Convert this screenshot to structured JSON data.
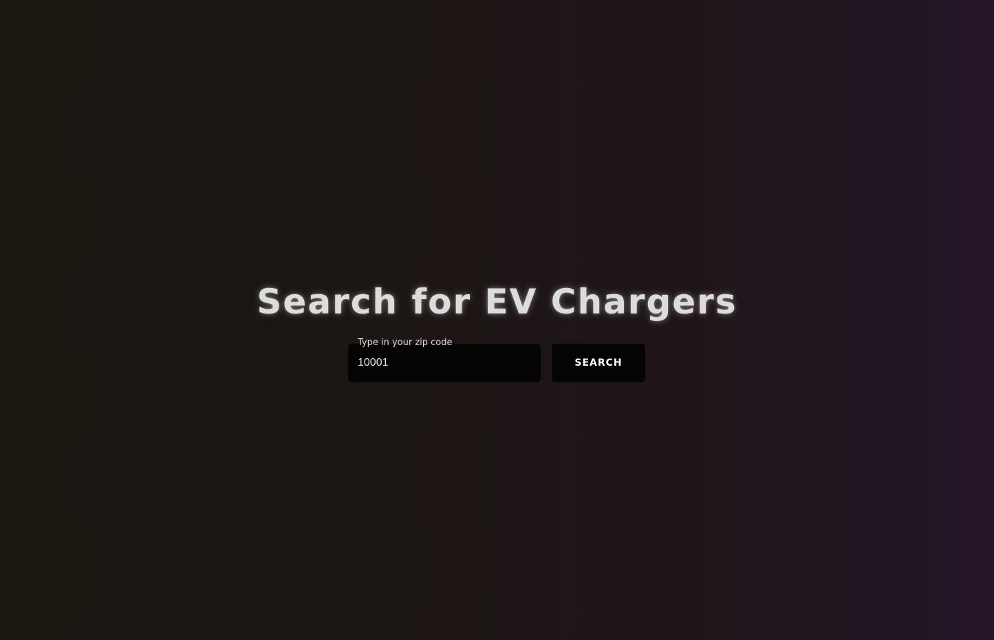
{
  "page": {
    "title": "Search for EV Chargers"
  },
  "search": {
    "label": "Type in your zip code",
    "value": "10001",
    "button_label": "SEARCH"
  },
  "colors": {
    "background_left": "#1a1610",
    "background_right": "#241628",
    "title_text": "#dcdcdc",
    "control_background": "#050404",
    "control_text": "#ffffff"
  }
}
